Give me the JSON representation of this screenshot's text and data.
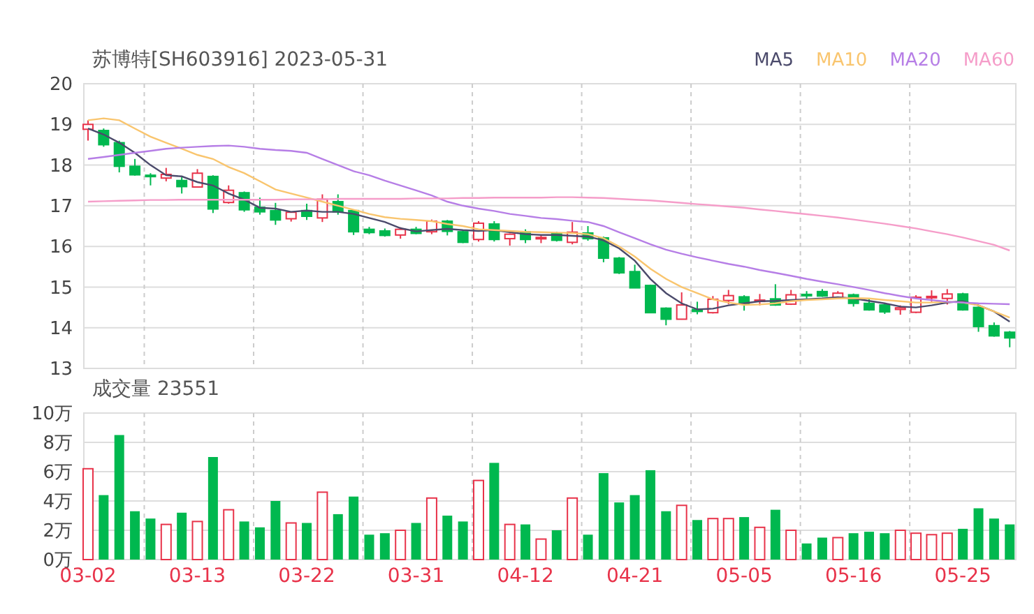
{
  "title": "苏博特[SH603916] 2023-05-31",
  "price_chart": {
    "chart_data": {
      "type": "candlestick",
      "grid": true,
      "ylim": [
        13,
        20
      ],
      "yticks": [
        13,
        14,
        15,
        16,
        17,
        18,
        19,
        20
      ],
      "ohlc": [
        [
          18.88,
          19.1,
          18.6,
          19.0
        ],
        [
          18.85,
          18.9,
          18.45,
          18.5
        ],
        [
          18.55,
          18.6,
          17.82,
          17.97
        ],
        [
          17.97,
          18.15,
          17.74,
          17.76
        ],
        [
          17.75,
          17.8,
          17.5,
          17.72
        ],
        [
          17.68,
          17.93,
          17.6,
          17.77
        ],
        [
          17.62,
          17.7,
          17.3,
          17.47
        ],
        [
          17.46,
          17.9,
          17.45,
          17.8
        ],
        [
          17.72,
          17.75,
          16.82,
          16.92
        ],
        [
          17.08,
          17.5,
          17.05,
          17.38
        ],
        [
          17.32,
          17.35,
          16.85,
          16.9
        ],
        [
          16.96,
          17.2,
          16.78,
          16.85
        ],
        [
          16.88,
          17.07,
          16.53,
          16.65
        ],
        [
          16.68,
          16.86,
          16.61,
          16.84
        ],
        [
          16.88,
          17.05,
          16.65,
          16.74
        ],
        [
          16.7,
          17.28,
          16.6,
          17.16
        ],
        [
          17.1,
          17.28,
          16.78,
          16.85
        ],
        [
          16.88,
          16.9,
          16.28,
          16.36
        ],
        [
          16.42,
          16.48,
          16.3,
          16.34
        ],
        [
          16.38,
          16.44,
          16.24,
          16.27
        ],
        [
          16.28,
          16.47,
          16.19,
          16.42
        ],
        [
          16.42,
          16.48,
          16.3,
          16.32
        ],
        [
          16.36,
          16.66,
          16.3,
          16.62
        ],
        [
          16.62,
          16.65,
          16.27,
          16.37
        ],
        [
          16.36,
          16.4,
          16.08,
          16.1
        ],
        [
          16.17,
          16.62,
          16.12,
          16.57
        ],
        [
          16.55,
          16.62,
          16.12,
          16.17
        ],
        [
          16.19,
          16.32,
          16.02,
          16.3
        ],
        [
          16.36,
          16.42,
          16.08,
          16.17
        ],
        [
          16.2,
          16.28,
          16.08,
          16.22
        ],
        [
          16.32,
          16.36,
          16.12,
          16.15
        ],
        [
          16.1,
          16.6,
          16.05,
          16.35
        ],
        [
          16.33,
          16.5,
          16.14,
          16.19
        ],
        [
          16.21,
          16.24,
          15.61,
          15.71
        ],
        [
          15.71,
          15.74,
          15.32,
          15.35
        ],
        [
          15.38,
          15.55,
          14.98,
          14.98
        ],
        [
          15.04,
          15.06,
          14.37,
          14.37
        ],
        [
          14.48,
          14.5,
          14.06,
          14.21
        ],
        [
          14.21,
          14.87,
          14.2,
          14.56
        ],
        [
          14.45,
          14.64,
          14.33,
          14.4
        ],
        [
          14.37,
          14.78,
          14.35,
          14.7
        ],
        [
          14.67,
          14.93,
          14.58,
          14.79
        ],
        [
          14.76,
          14.8,
          14.42,
          14.58
        ],
        [
          14.66,
          14.83,
          14.55,
          14.68
        ],
        [
          14.71,
          15.07,
          14.54,
          14.56
        ],
        [
          14.58,
          14.93,
          14.56,
          14.81
        ],
        [
          14.82,
          14.9,
          14.72,
          14.79
        ],
        [
          14.89,
          14.95,
          14.76,
          14.78
        ],
        [
          14.74,
          14.9,
          14.7,
          14.85
        ],
        [
          14.81,
          14.84,
          14.52,
          14.6
        ],
        [
          14.6,
          14.72,
          14.42,
          14.44
        ],
        [
          14.56,
          14.6,
          14.34,
          14.39
        ],
        [
          14.45,
          14.55,
          14.32,
          14.49
        ],
        [
          14.38,
          14.8,
          14.36,
          14.75
        ],
        [
          14.74,
          14.92,
          14.64,
          14.77
        ],
        [
          14.72,
          14.95,
          14.57,
          14.83
        ],
        [
          14.83,
          14.86,
          14.42,
          14.44
        ],
        [
          14.5,
          14.52,
          13.9,
          14.03
        ],
        [
          14.05,
          14.13,
          13.78,
          13.8
        ],
        [
          13.89,
          13.92,
          13.52,
          13.75
        ]
      ]
    }
  },
  "moving_averages": {
    "chart_data": {
      "type": "line",
      "ylim": [
        13,
        20
      ],
      "series": [
        {
          "name": "MA5",
          "color": "#4b4a6b",
          "values": [
            18.9,
            18.75,
            18.55,
            18.3,
            18.0,
            17.75,
            17.72,
            17.58,
            17.5,
            17.3,
            17.15,
            16.95,
            16.93,
            16.85,
            16.88,
            16.85,
            16.85,
            16.8,
            16.7,
            16.6,
            16.45,
            16.37,
            16.4,
            16.43,
            16.4,
            16.38,
            16.4,
            16.35,
            16.3,
            16.28,
            16.28,
            16.26,
            16.24,
            16.15,
            15.95,
            15.65,
            15.2,
            14.85,
            14.6,
            14.45,
            14.47,
            14.55,
            14.6,
            14.65,
            14.66,
            14.68,
            14.7,
            14.72,
            14.75,
            14.72,
            14.66,
            14.6,
            14.52,
            14.5,
            14.55,
            14.62,
            14.65,
            14.55,
            14.4,
            14.15
          ]
        },
        {
          "name": "MA10",
          "color": "#f9c56e",
          "values": [
            19.1,
            19.15,
            19.1,
            18.9,
            18.7,
            18.55,
            18.4,
            18.25,
            18.15,
            17.95,
            17.8,
            17.6,
            17.4,
            17.3,
            17.2,
            17.1,
            17.0,
            16.9,
            16.8,
            16.72,
            16.68,
            16.65,
            16.62,
            16.55,
            16.5,
            16.42,
            16.4,
            16.38,
            16.36,
            16.35,
            16.34,
            16.33,
            16.3,
            16.2,
            16.0,
            15.75,
            15.45,
            15.2,
            15.0,
            14.85,
            14.7,
            14.62,
            14.56,
            14.57,
            14.6,
            14.65,
            14.68,
            14.7,
            14.72,
            14.73,
            14.72,
            14.68,
            14.65,
            14.62,
            14.62,
            14.64,
            14.62,
            14.55,
            14.4,
            14.25
          ]
        },
        {
          "name": "MA20",
          "color": "#b67ee6",
          "values": [
            18.15,
            18.2,
            18.25,
            18.3,
            18.35,
            18.4,
            18.43,
            18.45,
            18.47,
            18.48,
            18.45,
            18.4,
            18.37,
            18.35,
            18.3,
            18.15,
            18.0,
            17.85,
            17.75,
            17.62,
            17.5,
            17.38,
            17.25,
            17.1,
            17.0,
            16.93,
            16.87,
            16.8,
            16.75,
            16.7,
            16.67,
            16.63,
            16.6,
            16.5,
            16.35,
            16.2,
            16.05,
            15.92,
            15.82,
            15.73,
            15.65,
            15.57,
            15.5,
            15.42,
            15.35,
            15.28,
            15.2,
            15.13,
            15.07,
            15.0,
            14.93,
            14.85,
            14.78,
            14.72,
            14.68,
            14.64,
            14.62,
            14.6,
            14.59,
            14.58
          ]
        },
        {
          "name": "MA60",
          "color": "#f59dc9",
          "values": [
            17.1,
            17.11,
            17.12,
            17.13,
            17.14,
            17.14,
            17.15,
            17.15,
            17.15,
            17.15,
            17.15,
            17.15,
            17.15,
            17.16,
            17.16,
            17.16,
            17.17,
            17.17,
            17.17,
            17.17,
            17.17,
            17.18,
            17.18,
            17.18,
            17.19,
            17.19,
            17.2,
            17.2,
            17.2,
            17.2,
            17.21,
            17.21,
            17.2,
            17.19,
            17.17,
            17.15,
            17.13,
            17.1,
            17.07,
            17.04,
            17.01,
            16.98,
            16.95,
            16.91,
            16.87,
            16.83,
            16.79,
            16.75,
            16.71,
            16.66,
            16.61,
            16.56,
            16.5,
            16.44,
            16.37,
            16.3,
            16.22,
            16.13,
            16.04,
            15.9
          ]
        }
      ]
    }
  },
  "volume_chart": {
    "title": "成交量 23551",
    "chart_data": {
      "type": "bar",
      "grid": true,
      "categories": [
        "03-02",
        null,
        null,
        null,
        null,
        null,
        null,
        "03-13",
        null,
        null,
        null,
        null,
        null,
        null,
        "03-22",
        null,
        null,
        null,
        null,
        null,
        null,
        "03-31",
        null,
        null,
        null,
        null,
        null,
        null,
        "04-12",
        null,
        null,
        null,
        null,
        null,
        null,
        "04-21",
        null,
        null,
        null,
        null,
        null,
        null,
        "05-05",
        null,
        null,
        null,
        null,
        null,
        null,
        "05-16",
        null,
        null,
        null,
        null,
        null,
        null,
        "05-25",
        null,
        null,
        null
      ],
      "ylim": [
        0,
        10
      ],
      "yticks": [
        {
          "value": 0,
          "label": "0万"
        },
        {
          "value": 2,
          "label": "2万"
        },
        {
          "value": 4,
          "label": "4万"
        },
        {
          "value": 6,
          "label": "6万"
        },
        {
          "value": 8,
          "label": "8万"
        },
        {
          "value": 10,
          "label": "10万"
        }
      ],
      "values": [
        6.2,
        4.4,
        8.5,
        3.3,
        2.8,
        2.4,
        3.2,
        2.6,
        7.0,
        3.4,
        2.6,
        2.2,
        4.0,
        2.5,
        2.5,
        4.6,
        3.1,
        4.3,
        1.7,
        1.8,
        2.0,
        2.5,
        4.2,
        3.0,
        2.6,
        5.4,
        6.6,
        2.4,
        2.4,
        1.4,
        2.0,
        4.2,
        1.7,
        5.9,
        3.9,
        4.4,
        6.1,
        3.3,
        3.7,
        2.7,
        2.8,
        2.8,
        2.9,
        2.2,
        3.4,
        2.0,
        1.1,
        1.5,
        1.5,
        1.8,
        1.9,
        1.8,
        2.0,
        1.8,
        1.7,
        1.8,
        2.1,
        3.5,
        2.8,
        2.4
      ]
    }
  }
}
